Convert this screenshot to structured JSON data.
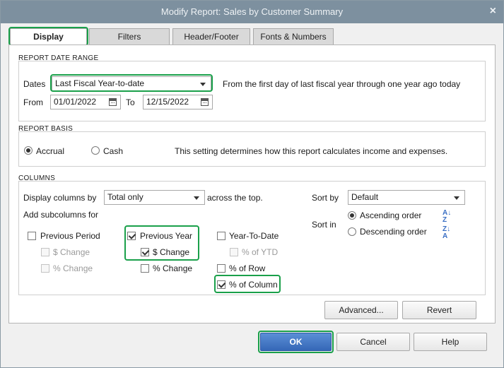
{
  "window": {
    "title": "Modify Report: Sales by Customer Summary",
    "close_glyph": "×"
  },
  "tabs": [
    {
      "label": "Display",
      "active": true
    },
    {
      "label": "Filters"
    },
    {
      "label": "Header/Footer"
    },
    {
      "label": "Fonts & Numbers"
    }
  ],
  "date_range": {
    "section_title": "REPORT DATE RANGE",
    "dates_label": "Dates",
    "dates_value": "Last Fiscal Year-to-date",
    "description": "From the first day of last fiscal year through one year ago today",
    "from_label": "From",
    "from_value": "01/01/2022",
    "to_label": "To",
    "to_value": "12/15/2022"
  },
  "basis": {
    "section_title": "REPORT BASIS",
    "accrual_label": "Accrual",
    "cash_label": "Cash",
    "selected": "Accrual",
    "description": "This setting determines how this report calculates income and expenses."
  },
  "columns": {
    "section_title": "COLUMNS",
    "display_label": "Display columns by",
    "display_value": "Total only",
    "across_label": "across the top.",
    "subcolumns_label": "Add subcolumns for",
    "sort_by_label": "Sort by",
    "sort_by_value": "Default",
    "sort_in_label": "Sort in",
    "ascending_label": "Ascending order",
    "descending_label": "Descending order",
    "sort_selected": "Ascending order",
    "previous_period": {
      "label": "Previous Period",
      "checked": false,
      "dollar_change": "$ Change",
      "percent_change": "% Change"
    },
    "previous_year": {
      "label": "Previous Year",
      "checked": true,
      "dollar_change": "$ Change",
      "dollar_change_checked": true,
      "percent_change": "% Change",
      "percent_change_checked": false
    },
    "ytd": {
      "label": "Year-To-Date",
      "checked": false,
      "percent_ytd": "% of YTD"
    },
    "percent_row": {
      "label": "% of Row",
      "checked": false
    },
    "percent_column": {
      "label": "% of Column",
      "checked": true
    }
  },
  "buttons": {
    "advanced": "Advanced...",
    "revert": "Revert",
    "ok": "OK",
    "cancel": "Cancel",
    "help": "Help"
  },
  "colors": {
    "highlight": "#1aa04a",
    "titlebar": "#7d909f",
    "primary_button": "#3567b7"
  }
}
